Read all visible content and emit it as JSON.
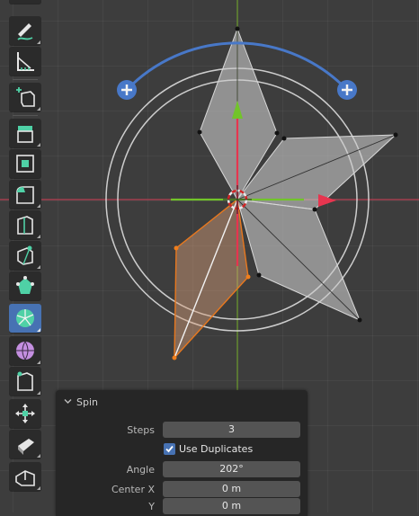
{
  "toolbar": {
    "tools": [
      {
        "id": "annotate",
        "icon": "annotate-pencil-icon"
      },
      {
        "id": "measure",
        "icon": "measure-ruler-icon"
      },
      {
        "id": "add-cube",
        "icon": "add-cube-icon"
      },
      {
        "id": "extrude",
        "icon": "extrude-region-icon"
      },
      {
        "id": "inset",
        "icon": "inset-faces-icon"
      },
      {
        "id": "bevel",
        "icon": "bevel-icon"
      },
      {
        "id": "loop-cut",
        "icon": "loop-cut-icon"
      },
      {
        "id": "knife",
        "icon": "knife-icon"
      },
      {
        "id": "poly-build",
        "icon": "poly-build-icon"
      },
      {
        "id": "spin",
        "icon": "spin-icon",
        "active": true
      },
      {
        "id": "smooth",
        "icon": "smooth-sphere-icon"
      },
      {
        "id": "edge-slide",
        "icon": "edge-slide-icon"
      },
      {
        "id": "shrink-fatten",
        "icon": "shrink-fatten-icon"
      },
      {
        "id": "shear",
        "icon": "shear-icon"
      },
      {
        "id": "rip",
        "icon": "rip-region-icon"
      }
    ]
  },
  "panel": {
    "title": "Spin",
    "steps_label": "Steps",
    "steps_value": "3",
    "use_duplicates_label": "Use Duplicates",
    "use_duplicates_checked": true,
    "angle_label": "Angle",
    "angle_value": "202°",
    "center_x_label": "Center X",
    "center_x_value": "0 m",
    "y_label": "Y",
    "y_value": "0 m"
  },
  "colors": {
    "viewport_bg": "#3d3d3d",
    "axis_x": "#b83f52",
    "axis_y": "#6a9a2b",
    "gizmo_arc": "#4878c8",
    "active_tool": "#4772b3",
    "mesh_face": "#c8c8c8",
    "selected_face": "#d9a07a",
    "selected_edge": "#e8781e"
  }
}
